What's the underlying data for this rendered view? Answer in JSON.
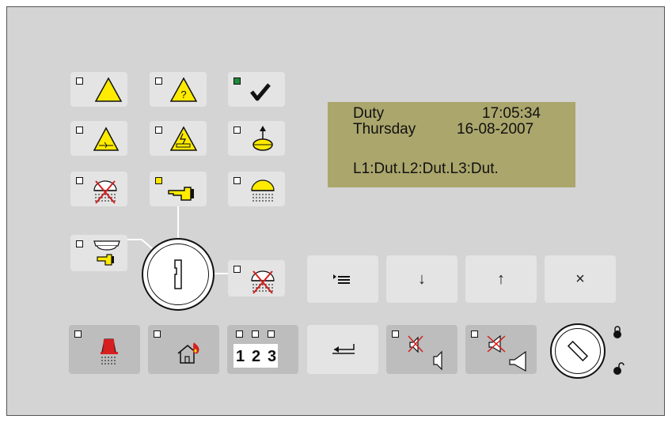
{
  "display": {
    "line1_left": "Duty",
    "line1_time": "17:05:34",
    "line2_day": "Thursday",
    "line2_date": "16-08-2007",
    "line4": "L1:Dut.L2:Dut.L3:Dut."
  },
  "nav": {
    "menu_icon": "menu-arrow-icon",
    "down": "↓",
    "up": "↑",
    "cancel": "×"
  },
  "zones": {
    "z1": "1",
    "z2": "2",
    "z3": "3"
  },
  "colors": {
    "panel": "#d4d4d4",
    "button": "#e4e4e4",
    "button_dark": "#bdbdbd",
    "lcd": "#aba66c",
    "warning_yellow": "#ffeb00",
    "led_green": "#1f8a3a",
    "alarm_red": "#d61f1f"
  }
}
